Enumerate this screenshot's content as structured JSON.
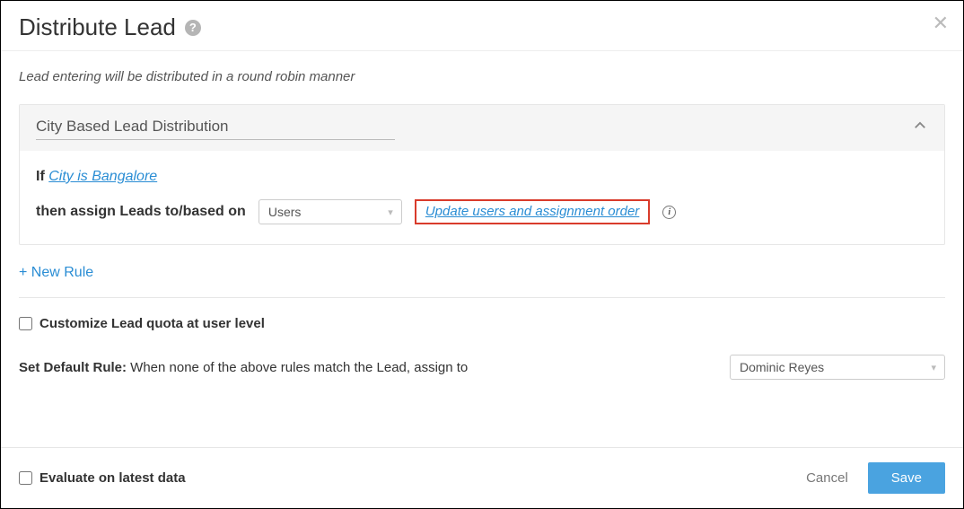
{
  "header": {
    "title": "Distribute Lead"
  },
  "subtitle": "Lead entering will be distributed in a round robin manner",
  "rule": {
    "name": "City Based Lead Distribution",
    "if_kw": "If",
    "condition_text": "City is Bangalore",
    "then_kw": "then assign Leads to/based on",
    "assign_target": "Users",
    "update_link": "Update users and assignment order"
  },
  "new_rule": "+ New Rule",
  "customize_quota_label": "Customize Lead quota at user level",
  "default_rule": {
    "label_strong": "Set Default Rule:",
    "label_rest": " When none of the above rules match the Lead, assign to",
    "value": "Dominic Reyes"
  },
  "footer": {
    "evaluate_label": "Evaluate on latest data",
    "cancel": "Cancel",
    "save": "Save"
  }
}
